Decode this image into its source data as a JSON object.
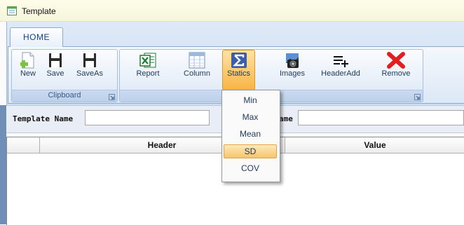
{
  "window": {
    "title": "Template",
    "icon": "window-app-icon"
  },
  "ribbon": {
    "tabs": [
      {
        "label": "HOME",
        "active": true
      }
    ],
    "groups": {
      "clipboard": {
        "label": "Clipboard",
        "buttons": [
          {
            "label": "New",
            "icon": "new-document-icon"
          },
          {
            "label": "Save",
            "icon": "save-icon"
          },
          {
            "label": "SaveAs",
            "icon": "save-as-icon"
          }
        ]
      },
      "template": {
        "label_visible": "ate",
        "buttons": [
          {
            "label": "Report",
            "icon": "excel-icon"
          },
          {
            "label": "Column",
            "icon": "column-table-icon"
          },
          {
            "label": "Statics",
            "icon": "sigma-icon",
            "active": true
          },
          {
            "label": "Images",
            "icon": "camera-icon"
          },
          {
            "label": "HeaderAdd",
            "icon": "header-add-icon"
          },
          {
            "label": "Remove",
            "icon": "remove-x-icon"
          }
        ]
      }
    }
  },
  "statics_menu": {
    "items": [
      {
        "label": "Min",
        "selected": false
      },
      {
        "label": "Max",
        "selected": false
      },
      {
        "label": "Mean",
        "selected": false
      },
      {
        "label": "SD",
        "selected": true
      },
      {
        "label": "COV",
        "selected": false
      }
    ]
  },
  "form": {
    "template_name_label": "Template Name",
    "template_name_value": "",
    "second_label_visible": "ame",
    "second_value": ""
  },
  "grid": {
    "columns": [
      "Header",
      "Value"
    ]
  },
  "colors": {
    "active_button": "#f8b445",
    "ribbon_bg": "#dde8f6",
    "remove_red": "#e02020",
    "excel_green": "#1d7a34"
  }
}
